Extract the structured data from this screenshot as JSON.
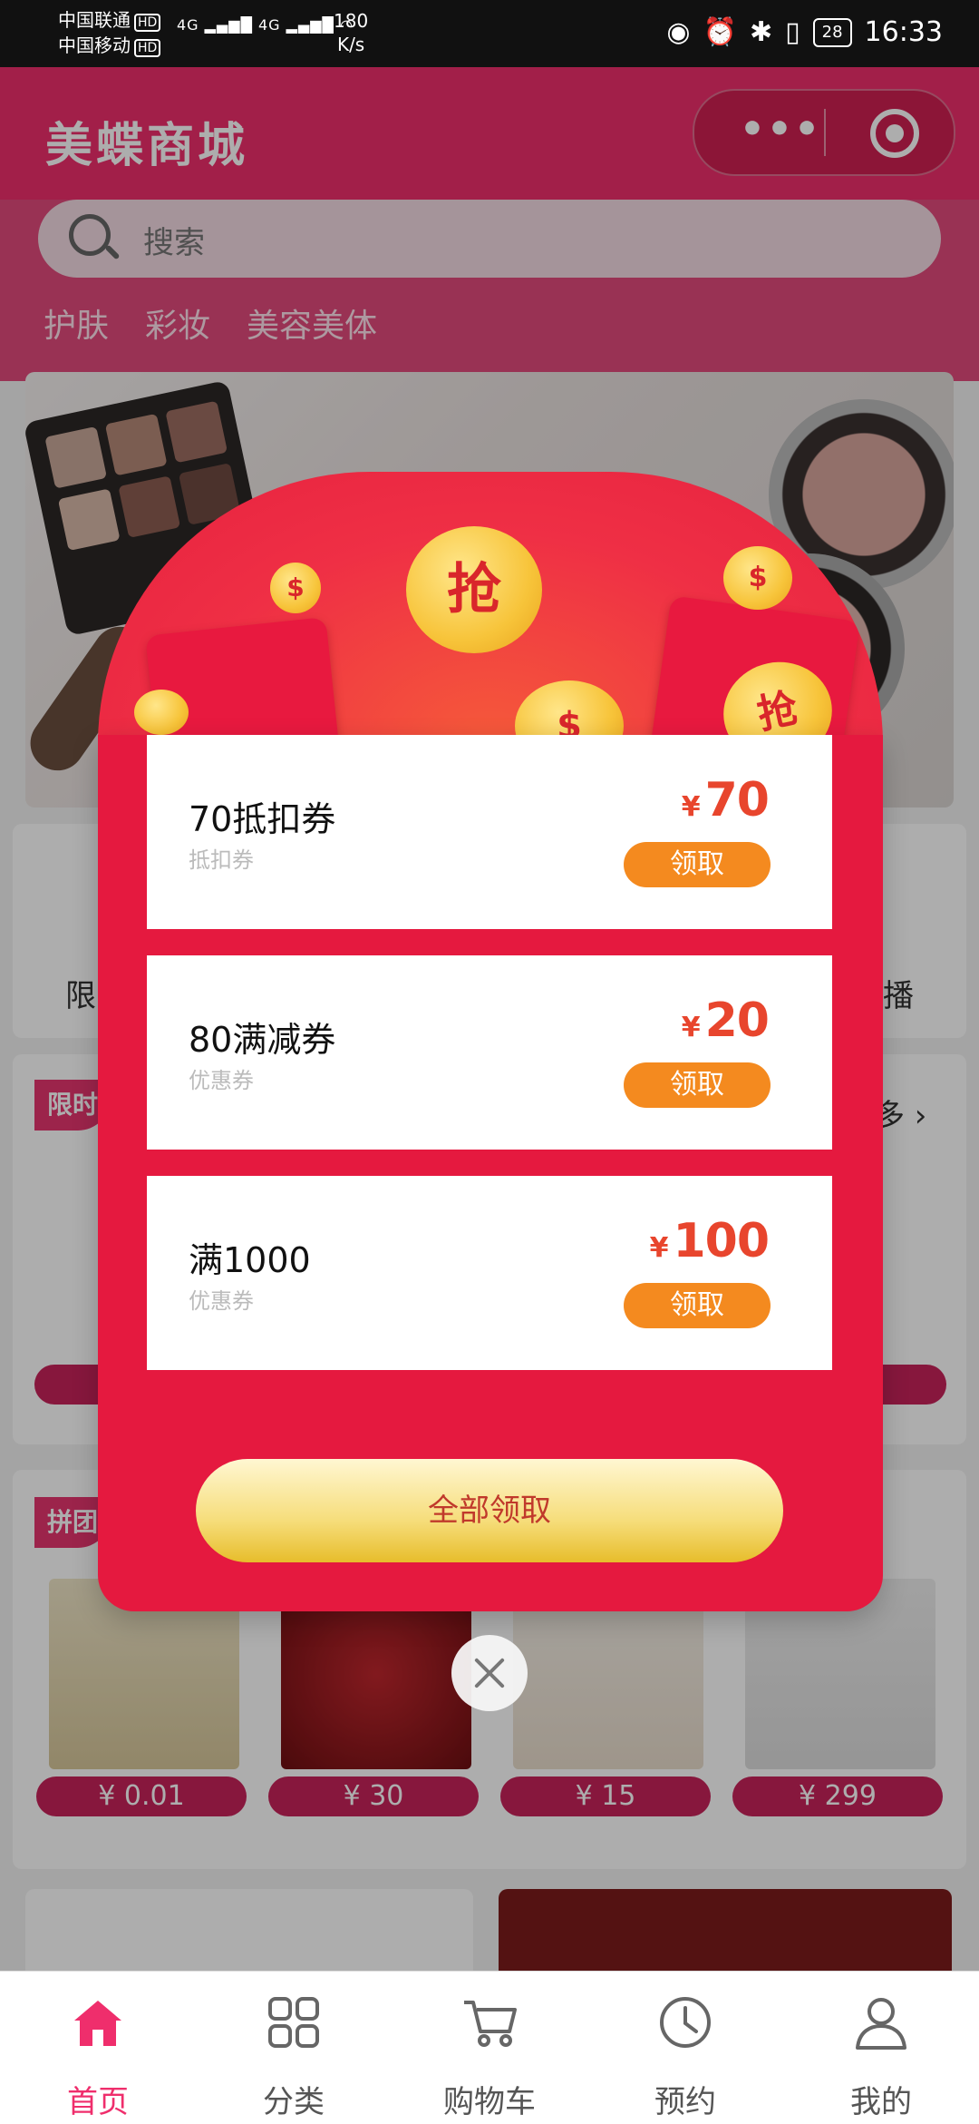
{
  "status_bar": {
    "carrier1": "中国联通",
    "carrier2": "中国移动",
    "hd": "HD",
    "network": "4G",
    "speed_value": "180",
    "speed_unit": "K/s",
    "battery": "28",
    "time": "16:33"
  },
  "header": {
    "title": "美蝶商城",
    "menu_dots": "•••"
  },
  "search": {
    "placeholder": "搜索"
  },
  "categories": [
    "护肤",
    "彩妆",
    "美容美体"
  ],
  "background": {
    "section1_left_text": "限",
    "section1_right_text": "播",
    "flash_tag": "限时",
    "more_label": "多",
    "group_tag": "拼团",
    "prices": [
      "¥ 0.01",
      "¥ 30",
      "¥ 15",
      "¥ 299"
    ]
  },
  "popup": {
    "coupons": [
      {
        "name": "70抵扣券",
        "type": "抵扣券",
        "currency": "¥",
        "amount": "70",
        "button": "领取"
      },
      {
        "name": "80满减券",
        "type": "优惠券",
        "currency": "¥",
        "amount": "20",
        "button": "领取"
      },
      {
        "name": "满1000",
        "type": "优惠券",
        "currency": "¥",
        "amount": "100",
        "button": "领取"
      }
    ],
    "claim_all": "全部领取",
    "coin_char": "抢",
    "coin_dollar": "$"
  },
  "tabbar": {
    "items": [
      {
        "label": "首页",
        "icon": "home-icon",
        "active": true
      },
      {
        "label": "分类",
        "icon": "grid-icon",
        "active": false
      },
      {
        "label": "购物车",
        "icon": "cart-icon",
        "active": false
      },
      {
        "label": "预约",
        "icon": "clock-icon",
        "active": false
      },
      {
        "label": "我的",
        "icon": "user-icon",
        "active": false
      }
    ]
  },
  "colors": {
    "brand": "#ef2e6c",
    "popup_red": "#e5193f",
    "coupon_amount": "#e8452d",
    "claim_button": "#f48a1f"
  }
}
